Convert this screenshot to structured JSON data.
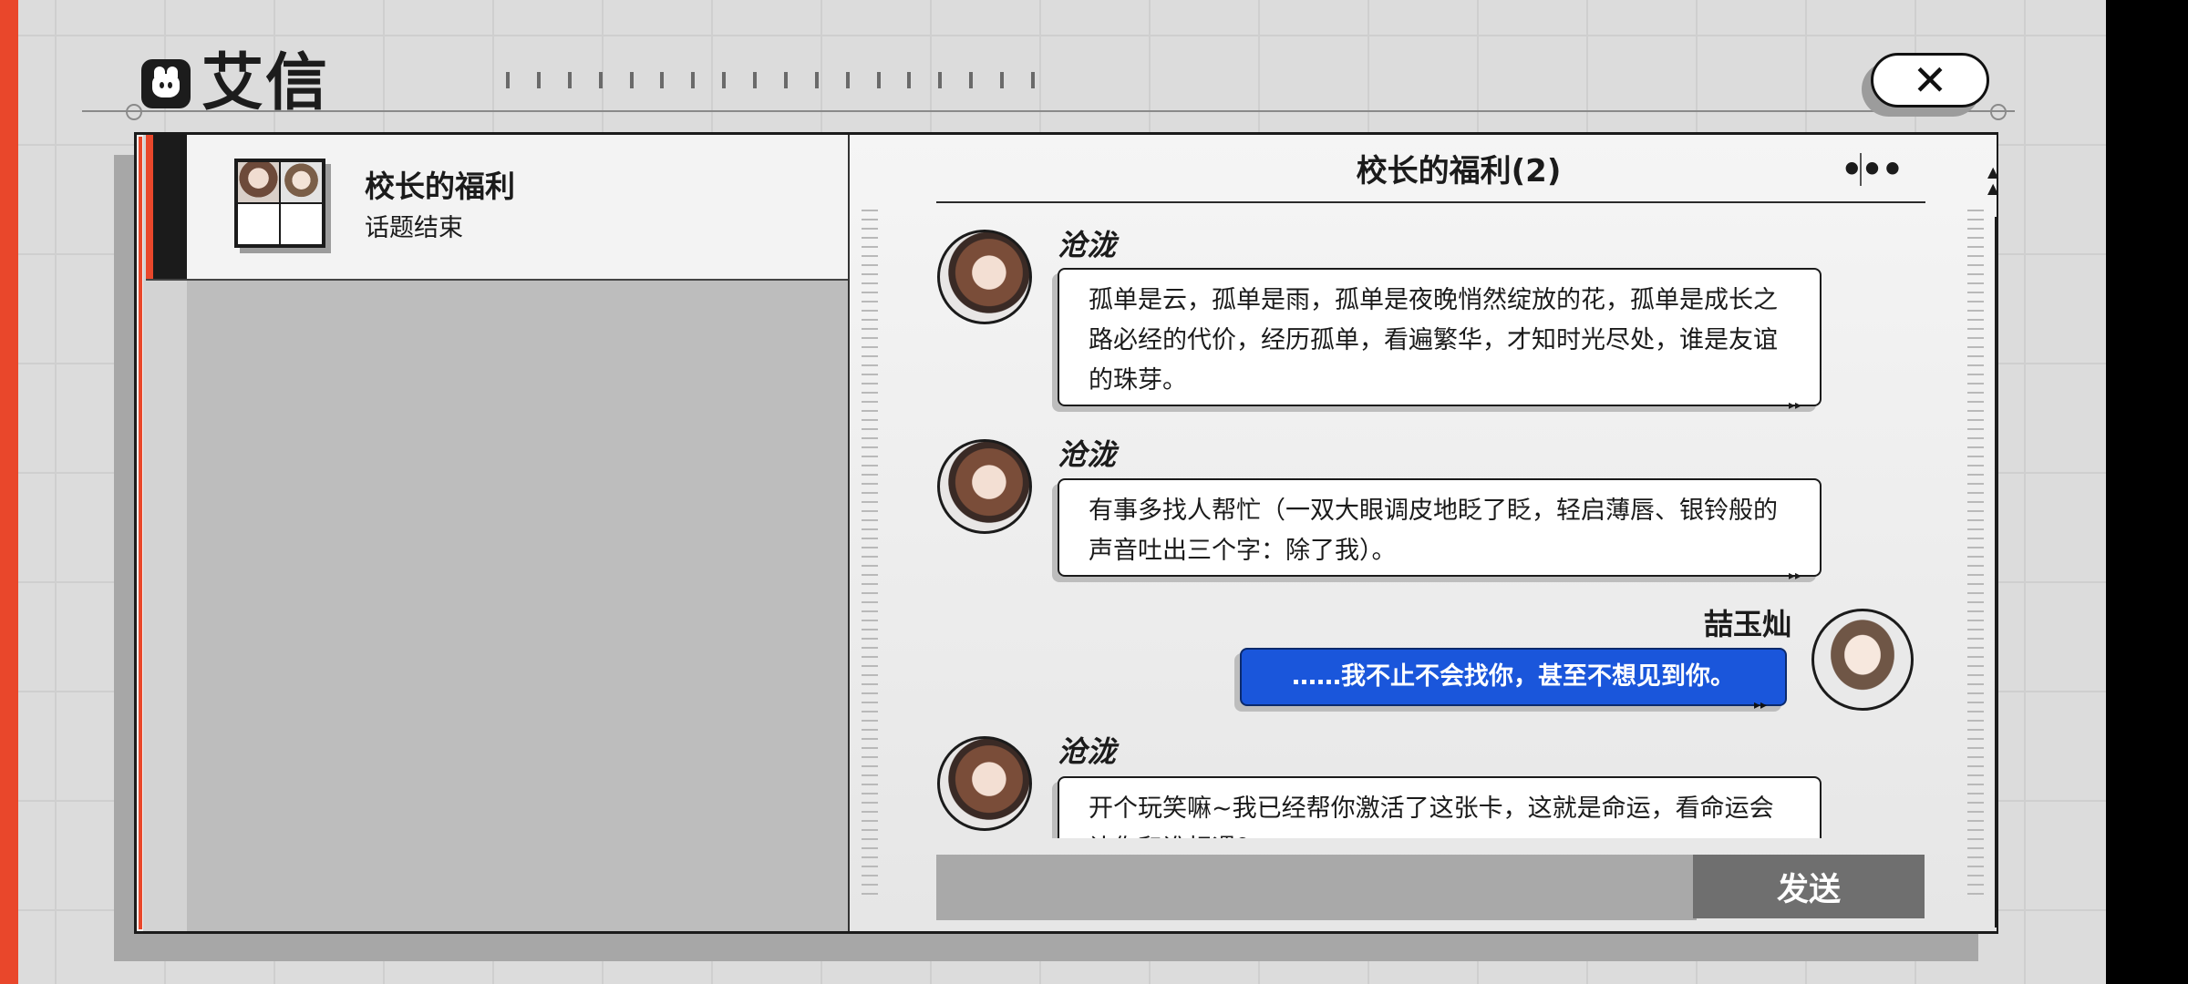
{
  "app": {
    "logo_text": "艾信"
  },
  "window": {
    "close_label": "✕"
  },
  "chat_list": [
    {
      "name": "校长的福利",
      "status": "话题结束"
    }
  ],
  "conversation": {
    "title": "校长的福利(2)",
    "more_label": "•••",
    "messages": [
      {
        "sender": "沧泷",
        "side": "left",
        "avatar": "female-avatar",
        "text": "孤单是云，孤单是雨，孤单是夜晚悄然绽放的花，孤单是成长之路必经的代价，经历孤单，看遍繁华，才知时光尽处，谁是友谊的珠芽。"
      },
      {
        "sender": "沧泷",
        "side": "left",
        "avatar": "female-avatar",
        "text": "有事多找人帮忙（一双大眼调皮地眨了眨，轻启薄唇、银铃般的声音吐出三个字：除了我）。"
      },
      {
        "sender": "喆玉灿",
        "side": "right",
        "avatar": "male-avatar",
        "text": "……我不止不会找你，甚至不想见到你。"
      },
      {
        "sender": "沧泷",
        "side": "left",
        "avatar": "female-avatar",
        "text": "开个玩笑嘛~我已经帮你激活了这张卡，这就是命运，看命运会让你和谁相遇？"
      }
    ]
  },
  "composer": {
    "send_label": "发送",
    "value": ""
  },
  "colors": {
    "accent_red": "#e9472b",
    "my_bubble": "#1a56db",
    "send_button": "#6f6f6f"
  }
}
